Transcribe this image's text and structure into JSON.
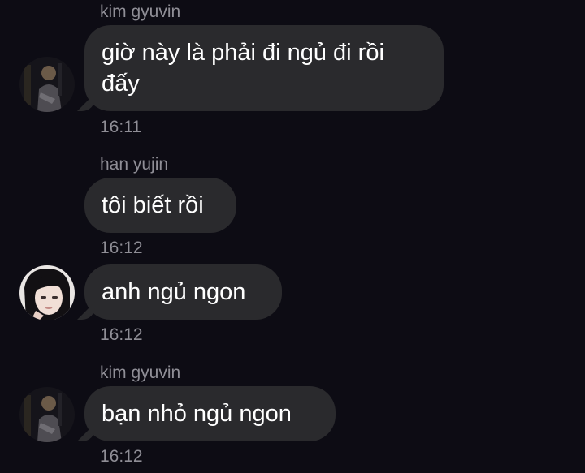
{
  "messages": [
    {
      "sender": "kim gyuvin",
      "text": "giờ này là phải đi ngủ đi rồi đấy",
      "time": "16:11"
    },
    {
      "sender": "han yujin",
      "text": "tôi biết rồi",
      "time": "16:12"
    },
    {
      "sender": "",
      "text": "anh ngủ ngon",
      "time": "16:12"
    },
    {
      "sender": "kim gyuvin",
      "text": "bạn nhỏ ngủ ngon",
      "time": "16:12"
    }
  ],
  "avatars": [
    {
      "name": "avatar-kim-gyuvin-photo"
    },
    {
      "name": "avatar-han-yujin-photo"
    },
    {
      "name": "avatar-kim-gyuvin-photo"
    }
  ],
  "colors": {
    "background": "#0d0c14",
    "bubble": "#2a2a2d",
    "meta_text": "#8f8e96",
    "message_text": "#ffffff"
  }
}
